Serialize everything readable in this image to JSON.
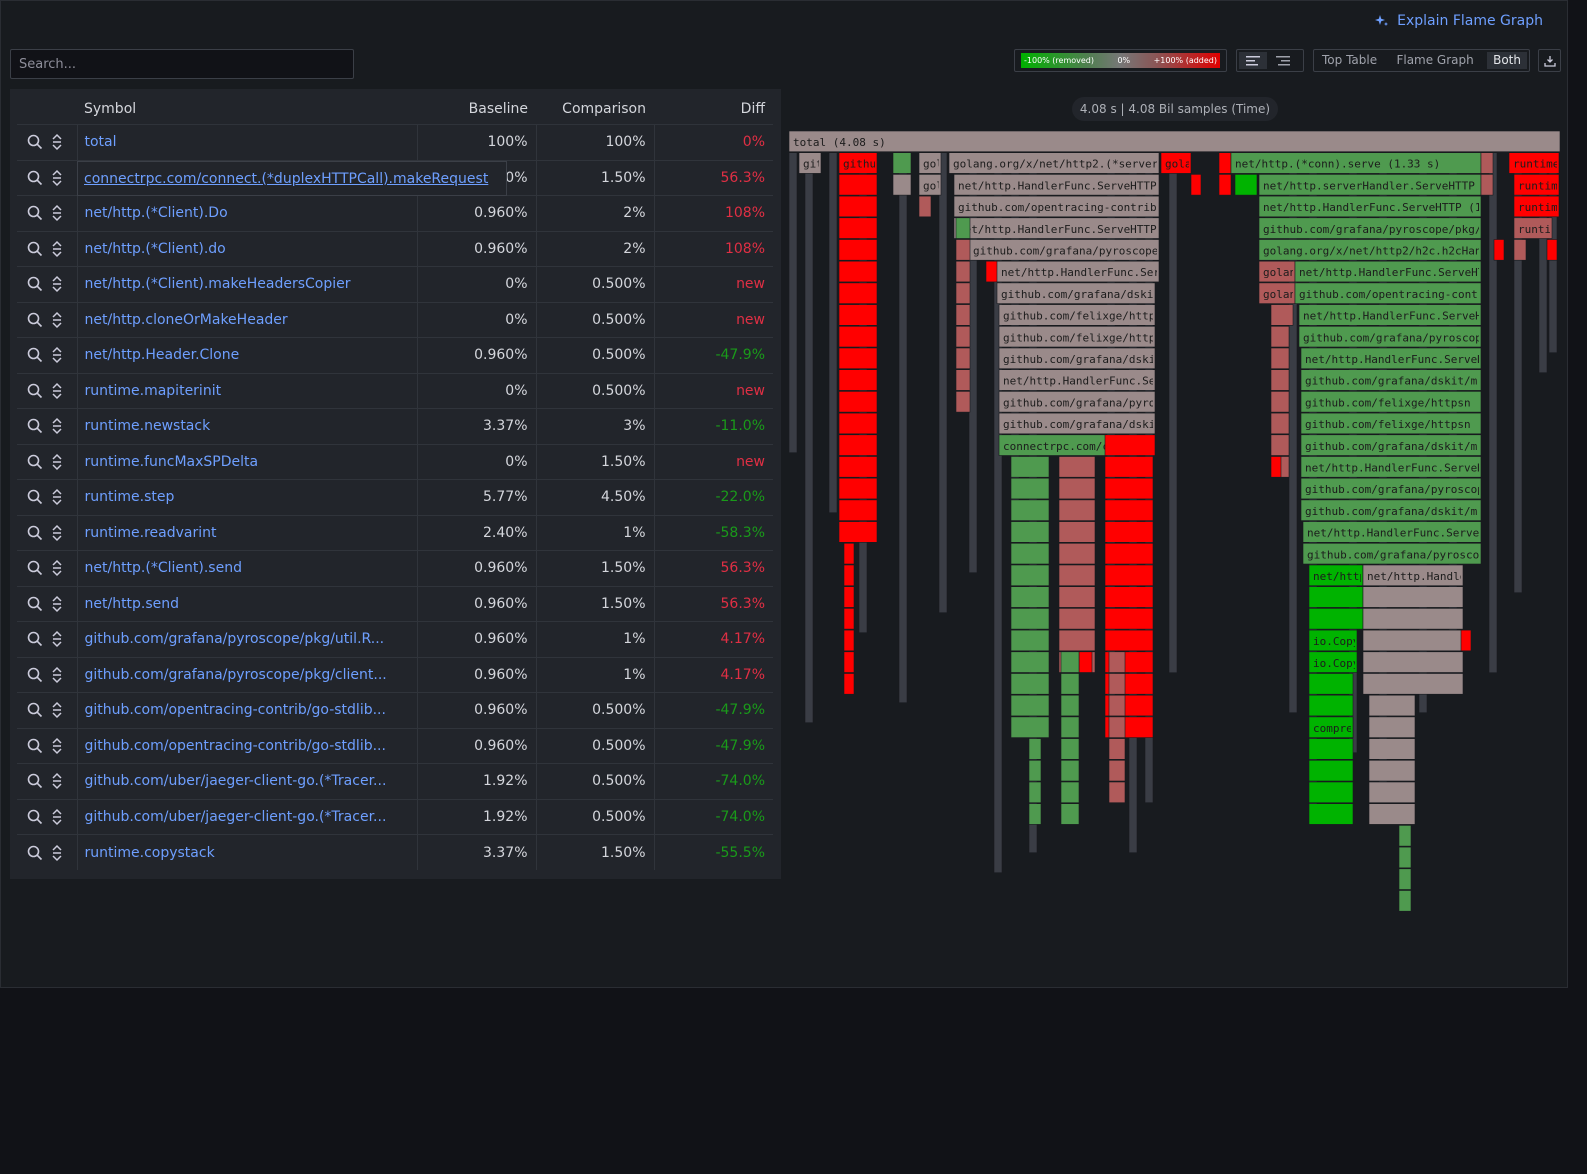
{
  "header": {
    "explain_label": "Explain Flame Graph"
  },
  "search": {
    "placeholder": "Search..."
  },
  "diff_legend": {
    "removed": "-100% (removed)",
    "zero": "0%",
    "added": "+100% (added)"
  },
  "view_modes": {
    "top_table": "Top Table",
    "flame_graph": "Flame Graph",
    "both": "Both",
    "selected": "Both"
  },
  "table": {
    "columns": {
      "symbol": "Symbol",
      "baseline": "Baseline",
      "comparison": "Comparison",
      "diff": "Diff"
    },
    "rows": [
      {
        "symbol": "total",
        "baseline": "100%",
        "comparison": "100%",
        "diff": "0%",
        "sign": "pos"
      },
      {
        "symbol": "connectrpc.com/connect.(*duplexHTTPCall).makeRequest",
        "baseline": "0.960%",
        "comparison": "1.50%",
        "diff": "56.3%",
        "sign": "pos"
      },
      {
        "symbol": "net/http.(*Client).Do",
        "baseline": "0.960%",
        "comparison": "2%",
        "diff": "108%",
        "sign": "pos"
      },
      {
        "symbol": "net/http.(*Client).do",
        "baseline": "0.960%",
        "comparison": "2%",
        "diff": "108%",
        "sign": "pos"
      },
      {
        "symbol": "net/http.(*Client).makeHeadersCopier",
        "baseline": "0%",
        "comparison": "0.500%",
        "diff": "new",
        "sign": "pos"
      },
      {
        "symbol": "net/http.cloneOrMakeHeader",
        "baseline": "0%",
        "comparison": "0.500%",
        "diff": "new",
        "sign": "pos"
      },
      {
        "symbol": "net/http.Header.Clone",
        "baseline": "0.960%",
        "comparison": "0.500%",
        "diff": "-47.9%",
        "sign": "neg"
      },
      {
        "symbol": "runtime.mapiterinit",
        "baseline": "0%",
        "comparison": "0.500%",
        "diff": "new",
        "sign": "pos"
      },
      {
        "symbol": "runtime.newstack",
        "baseline": "3.37%",
        "comparison": "3%",
        "diff": "-11.0%",
        "sign": "neg"
      },
      {
        "symbol": "runtime.funcMaxSPDelta",
        "baseline": "0%",
        "comparison": "1.50%",
        "diff": "new",
        "sign": "pos"
      },
      {
        "symbol": "runtime.step",
        "baseline": "5.77%",
        "comparison": "4.50%",
        "diff": "-22.0%",
        "sign": "neg"
      },
      {
        "symbol": "runtime.readvarint",
        "baseline": "2.40%",
        "comparison": "1%",
        "diff": "-58.3%",
        "sign": "neg"
      },
      {
        "symbol": "net/http.(*Client).send",
        "baseline": "0.960%",
        "comparison": "1.50%",
        "diff": "56.3%",
        "sign": "pos"
      },
      {
        "symbol": "net/http.send",
        "baseline": "0.960%",
        "comparison": "1.50%",
        "diff": "56.3%",
        "sign": "pos"
      },
      {
        "symbol": "github.com/grafana/pyroscope/pkg/util.R...",
        "baseline": "0.960%",
        "comparison": "1%",
        "diff": "4.17%",
        "sign": "pos"
      },
      {
        "symbol": "github.com/grafana/pyroscope/pkg/client...",
        "baseline": "0.960%",
        "comparison": "1%",
        "diff": "4.17%",
        "sign": "pos"
      },
      {
        "symbol": "github.com/opentracing-contrib/go-stdlib...",
        "baseline": "0.960%",
        "comparison": "0.500%",
        "diff": "-47.9%",
        "sign": "neg"
      },
      {
        "symbol": "github.com/opentracing-contrib/go-stdlib...",
        "baseline": "0.960%",
        "comparison": "0.500%",
        "diff": "-47.9%",
        "sign": "neg"
      },
      {
        "symbol": "github.com/uber/jaeger-client-go.(*Tracer...",
        "baseline": "1.92%",
        "comparison": "0.500%",
        "diff": "-74.0%",
        "sign": "neg"
      },
      {
        "symbol": "github.com/uber/jaeger-client-go.(*Tracer...",
        "baseline": "1.92%",
        "comparison": "0.500%",
        "diff": "-74.0%",
        "sign": "neg"
      },
      {
        "symbol": "runtime.copystack",
        "baseline": "3.37%",
        "comparison": "1.50%",
        "diff": "-55.5%",
        "sign": "neg"
      }
    ]
  },
  "flamegraph": {
    "stats": "4.08 s | 4.08 Bil samples (Time)",
    "colors": {
      "added": "#ff0000",
      "removed": "#00b300",
      "neutral": "#9a8a8a",
      "background": "#3a3d45"
    },
    "frames": [
      {
        "label": "total (4.08 s)",
        "kind": "neutral"
      },
      {
        "label": "gith",
        "kind": "neutral"
      },
      {
        "label": "github",
        "kind": "added"
      },
      {
        "label": "gol",
        "kind": "neutral"
      },
      {
        "label": "golang.org/x/net/http2.(*serverCon",
        "kind": "neutral"
      },
      {
        "label": "golang",
        "kind": "added"
      },
      {
        "label": "net/http.(*conn).serve (1.33 s)",
        "kind": "removed"
      },
      {
        "label": "runtime.",
        "kind": "added"
      },
      {
        "label": "net/http.HandlerFunc.ServeHTTP (1",
        "kind": "neutral"
      },
      {
        "label": "net/http.serverHandler.ServeHTTP (1.",
        "kind": "removed"
      },
      {
        "label": "github.com/opentracing-contrib/go",
        "kind": "neutral"
      },
      {
        "label": "net/http.HandlerFunc.ServeHTTP (1.18",
        "kind": "removed"
      },
      {
        "label": "github.com/grafana/pyroscope/pkg/uti",
        "kind": "removed"
      },
      {
        "label": "github.com/grafana/pyroscope/r",
        "kind": "neutral"
      },
      {
        "label": "golang.org/x/net/http2/h2c.h2cHandle",
        "kind": "removed"
      },
      {
        "label": "net/http.HandlerFunc.Serve",
        "kind": "neutral"
      },
      {
        "label": "net/http.HandlerFunc.ServeHTTP",
        "kind": "removed"
      },
      {
        "label": "github.com/grafana/dskit/m",
        "kind": "neutral"
      },
      {
        "label": "github.com/opentracing-contrib",
        "kind": "removed"
      },
      {
        "label": "github.com/felixge/httpsn",
        "kind": "neutral"
      },
      {
        "label": "github.com/grafana/pyroscope/",
        "kind": "removed"
      },
      {
        "label": "connectrpc.com/c",
        "kind": "removed"
      },
      {
        "label": "io.CopyN",
        "kind": "removed"
      },
      {
        "label": "compres",
        "kind": "removed"
      }
    ]
  }
}
